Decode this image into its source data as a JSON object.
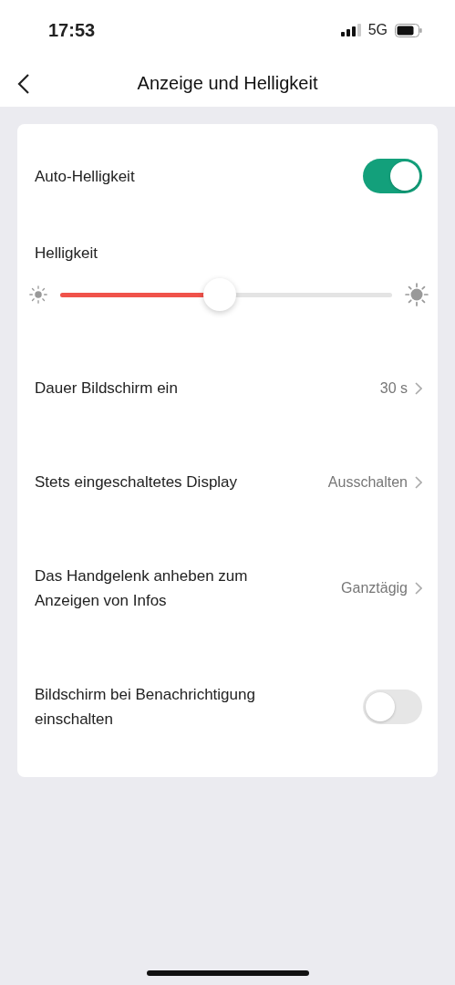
{
  "status_bar": {
    "time": "17:53",
    "network": "5G"
  },
  "nav": {
    "title": "Anzeige und Helligkeit"
  },
  "settings": [
    {
      "kind": "toggle",
      "label": "Auto-Helligkeit",
      "on": true
    },
    {
      "kind": "slider",
      "label": "Helligkeit",
      "level": 0.48
    },
    {
      "kind": "link",
      "label": "Dauer Bildschirm ein",
      "value": "30 s"
    },
    {
      "kind": "link",
      "label": "Stets eingeschaltetes Display",
      "value": "Ausschalten"
    },
    {
      "kind": "link",
      "label": "Das Handgelenk anheben zum Anzeigen von Infos",
      "value": "Ganztägig"
    },
    {
      "kind": "toggle",
      "label": "Bildschirm bei Benachrichtigung einschalten",
      "on": false
    }
  ]
}
